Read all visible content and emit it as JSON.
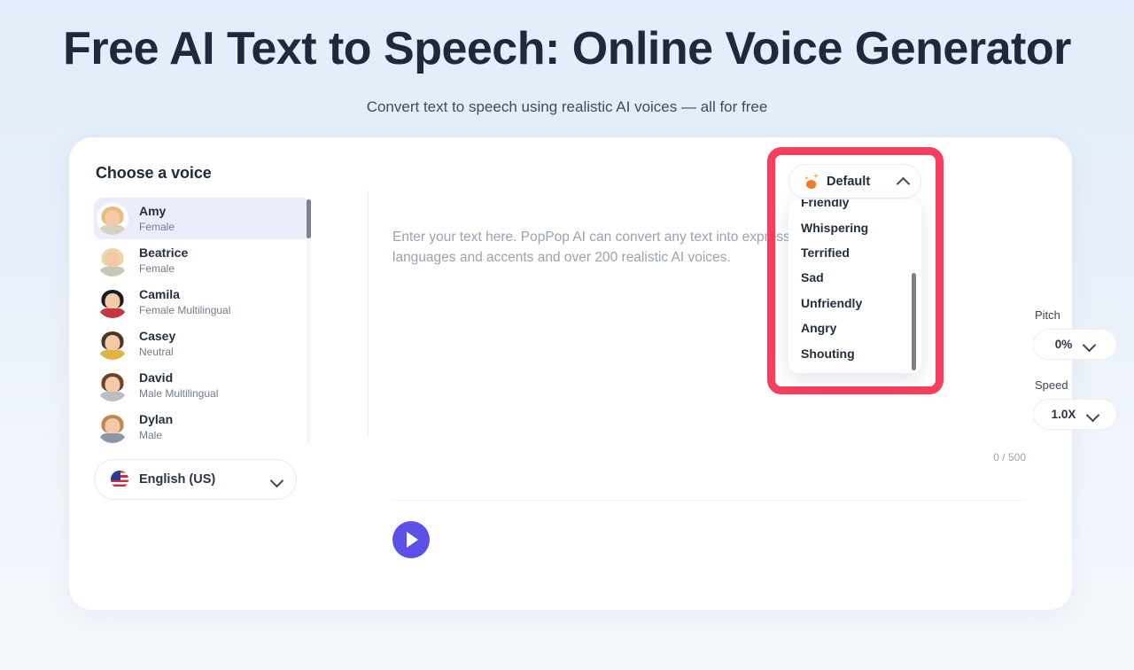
{
  "header": {
    "title": "Free AI Text to Speech: Online Voice Generator",
    "subtitle": "Convert text to speech using realistic AI voices — all for free"
  },
  "voice_panel": {
    "title": "Choose a voice",
    "voices": [
      {
        "name": "Amy",
        "gender": "Female",
        "selected": true,
        "hair": "#e3bd7e",
        "body": "#d9cfc2"
      },
      {
        "name": "Beatrice",
        "gender": "Female",
        "selected": false,
        "hair": "#e8d9a8",
        "body": "#c9c7b4"
      },
      {
        "name": "Camila",
        "gender": "Female Multilingual",
        "selected": false,
        "hair": "#1c1a1d",
        "body": "#c2383c"
      },
      {
        "name": "Casey",
        "gender": "Neutral",
        "selected": false,
        "hair": "#4a3526",
        "body": "#e0b441"
      },
      {
        "name": "David",
        "gender": "Male Multilingual",
        "selected": false,
        "hair": "#6b4328",
        "body": "#b9bec6"
      },
      {
        "name": "Dylan",
        "gender": "Male",
        "selected": false,
        "hair": "#c0884b",
        "body": "#8a97a8"
      }
    ],
    "language": {
      "label": "English (US)",
      "flag": "us-flag-icon",
      "chevron": "chevron-down-icon"
    }
  },
  "editor": {
    "placeholder": "Enter your text here. PopPop AI can convert any text into expressive speech. languages and accents and over 200 realistic AI voices.",
    "value": "",
    "char_count": "0 / 500",
    "play_button_label": "play-icon"
  },
  "emotion": {
    "selected": "Default",
    "icon": "sparkle-icon",
    "chevron": "chevron-up-icon",
    "expanded": true,
    "options": [
      "Friendly",
      "Whispering",
      "Terrified",
      "Sad",
      "Unfriendly",
      "Angry",
      "Shouting"
    ]
  },
  "controls": {
    "pitch": {
      "label": "Pitch",
      "value": "0%",
      "chevron": "chevron-down-icon"
    },
    "speed": {
      "label": "Speed",
      "value": "1.0X",
      "chevron": "chevron-down-icon"
    }
  },
  "annotation": {
    "highlight_color": "#f43f5e"
  }
}
